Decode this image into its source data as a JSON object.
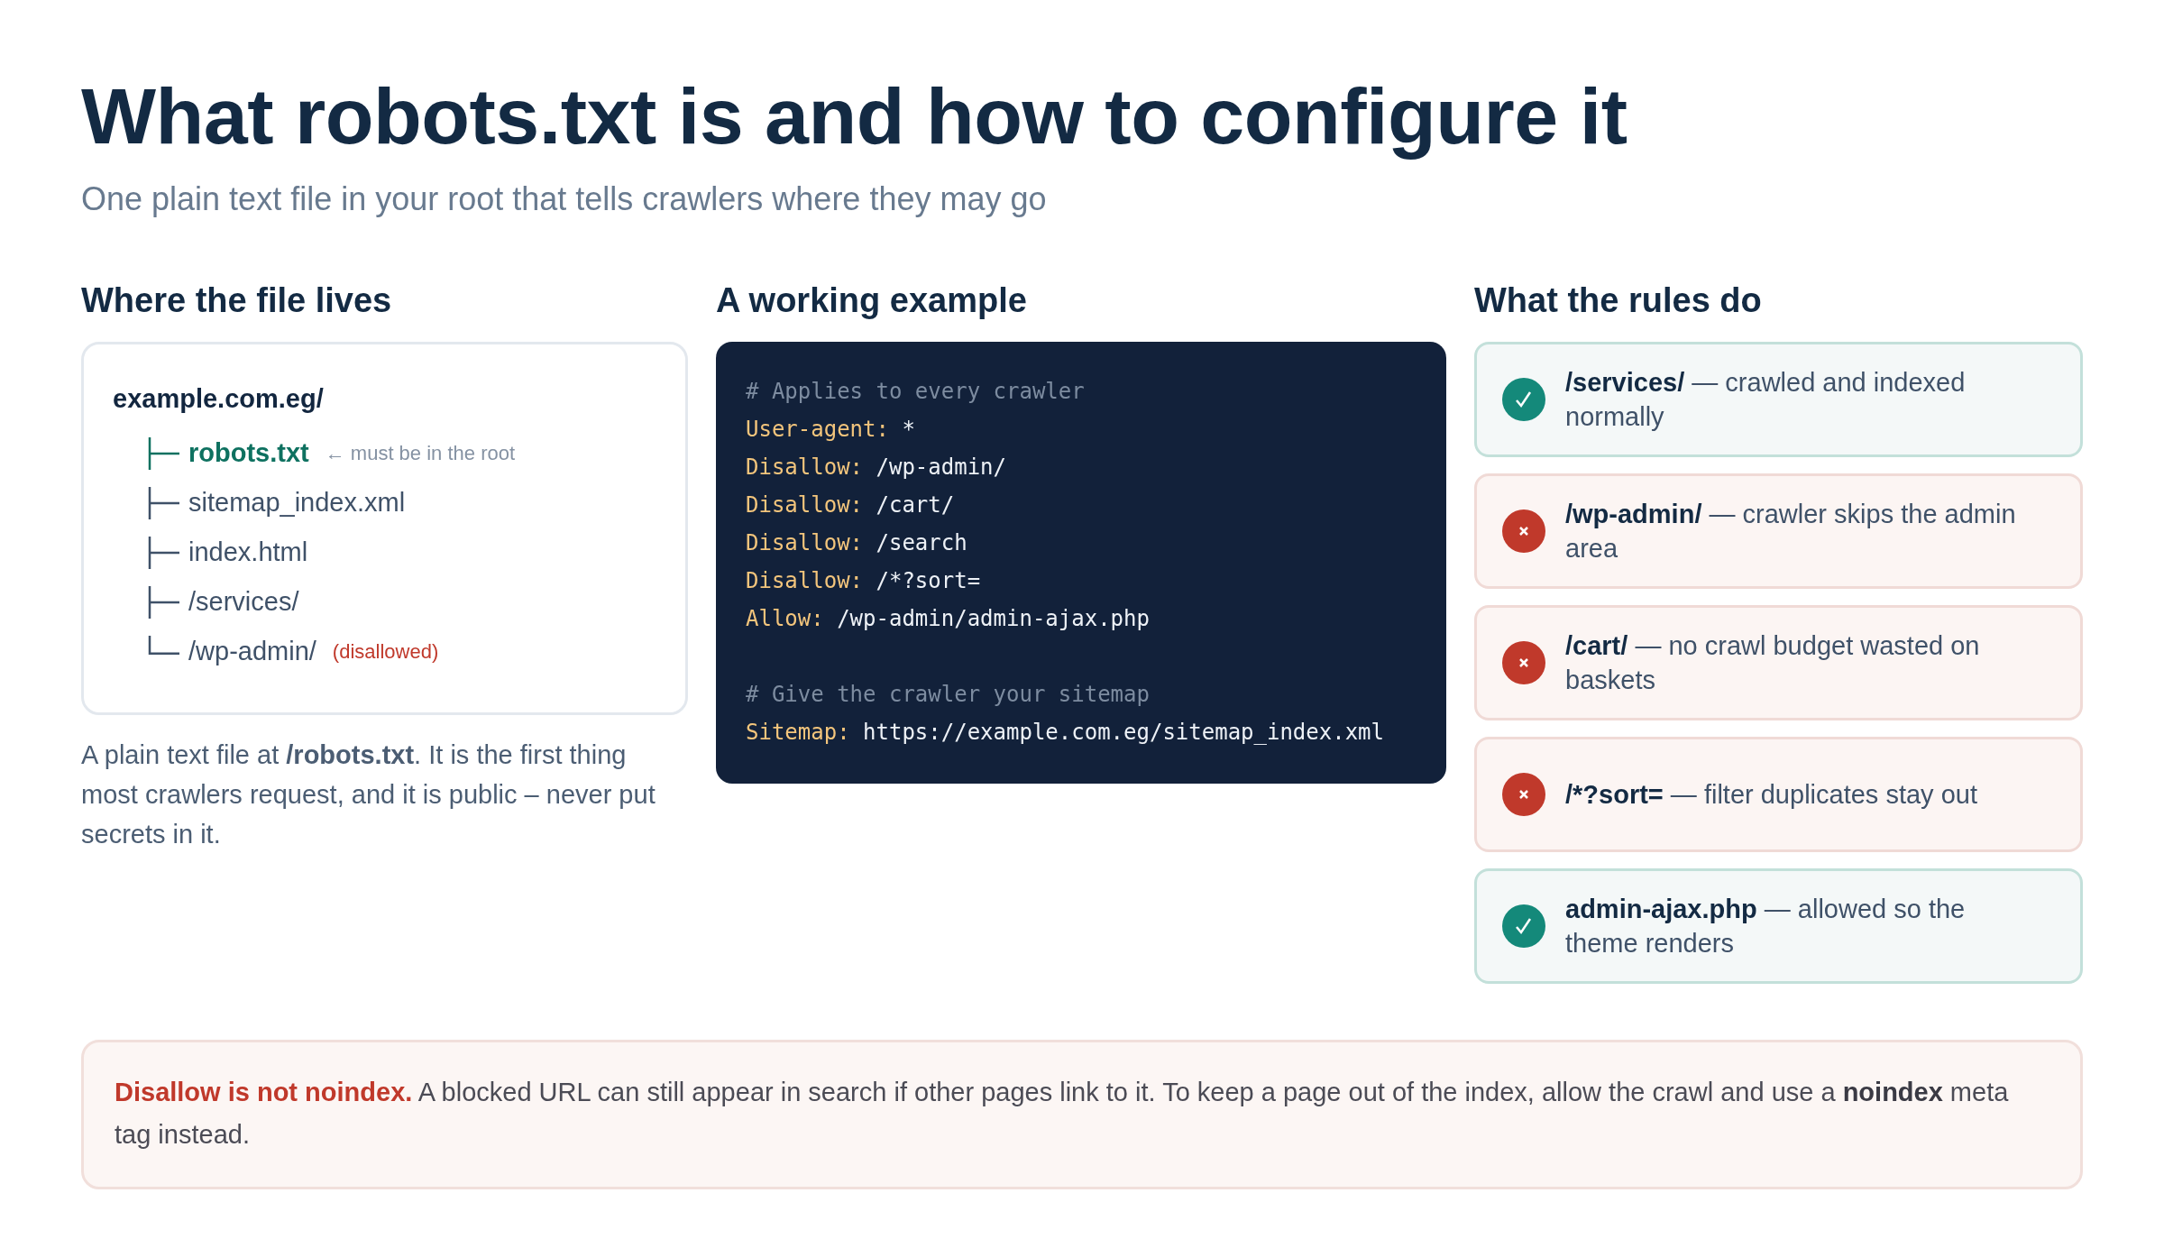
{
  "title": "What robots.txt is and how to configure it",
  "subtitle": "One plain text file in your root that tells crawlers where they may go",
  "location": {
    "heading": "Where the file lives",
    "root": "example.com.eg/",
    "items": [
      {
        "name": "robots.txt",
        "kind": "highlight",
        "last": false,
        "note": "← must be in the root"
      },
      {
        "name": "sitemap_index.xml",
        "kind": "plain",
        "last": false
      },
      {
        "name": "index.html",
        "kind": "plain",
        "last": false
      },
      {
        "name": "/services/",
        "kind": "plain",
        "last": false
      },
      {
        "name": "/wp-admin/",
        "kind": "plain",
        "last": true,
        "note": "(disallowed)"
      }
    ],
    "description": "A plain text file at **/robots.txt**. It is the first thing most crawlers request, and it is public – never put secrets in it."
  },
  "example": {
    "heading": "A working example",
    "lines": [
      {
        "kind": "comment",
        "text": "# Applies to every crawler"
      },
      {
        "kind": "directive",
        "key": "User-agent:",
        "value": "*"
      },
      {
        "kind": "directive",
        "key": "Disallow:",
        "value": "/wp-admin/"
      },
      {
        "kind": "directive",
        "key": "Disallow:",
        "value": "/cart/"
      },
      {
        "kind": "directive",
        "key": "Disallow:",
        "value": "/search"
      },
      {
        "kind": "directive",
        "key": "Disallow:",
        "value": "/*?sort="
      },
      {
        "kind": "directive",
        "key": "Allow:",
        "value": "/wp-admin/admin-ajax.php"
      },
      {
        "kind": "blank"
      },
      {
        "kind": "comment",
        "text": "# Give the crawler your sitemap"
      },
      {
        "kind": "directive",
        "key": "Sitemap:",
        "value": "https://example.com.eg/sitemap_index.xml"
      }
    ]
  },
  "rules": {
    "heading": "What the rules do",
    "items": [
      {
        "kind": "allow",
        "path": "/services/",
        "text": "— crawled and indexed normally"
      },
      {
        "kind": "block",
        "path": "/wp-admin/",
        "text": "— crawler skips the admin area"
      },
      {
        "kind": "block",
        "path": "/cart/",
        "text": "— no crawl budget wasted on baskets"
      },
      {
        "kind": "block",
        "path": "/*?sort=",
        "text": "— filter duplicates stay out"
      },
      {
        "kind": "allow",
        "path": "admin-ajax.php",
        "text": "— allowed so the theme renders"
      }
    ]
  },
  "callout": {
    "lead": "Disallow is not noindex.",
    "body": "A blocked URL can still appear in search if other pages link to it. To keep a page out of the index, allow the crawl and use a **noindex** meta tag instead."
  }
}
